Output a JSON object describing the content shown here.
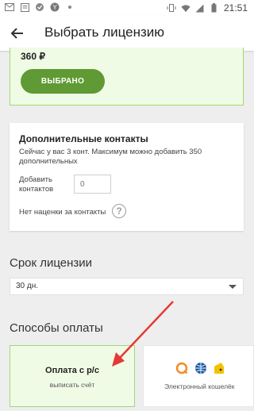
{
  "status_bar": {
    "time": "21:51",
    "left_icons": [
      "mail-icon",
      "news-icon",
      "app-icon",
      "yandex-icon",
      "dot-icon"
    ],
    "right_icons": [
      "vibrate-icon",
      "wifi-icon",
      "signal-icon",
      "battery-icon"
    ]
  },
  "app_bar": {
    "back_icon": "arrow-back-icon",
    "title": "Выбрать лицензию"
  },
  "license": {
    "price": "360 ₽",
    "selected_button": "ВЫБРАНО"
  },
  "contacts": {
    "heading": "Дополнительные контакты",
    "description": "Сейчас у вас 3 конт. Максимум можно добавить 350 дополнительных",
    "add_label": "Добавить контактов",
    "add_placeholder": "0",
    "no_markup": "Нет наценки за контакты",
    "help_icon": "?"
  },
  "term": {
    "heading": "Срок лицензии",
    "selected": "30 дн."
  },
  "payment": {
    "heading": "Способы оплаты",
    "methods": [
      {
        "title": "Оплата с р/с",
        "subtitle": "выписать счёт",
        "selected": true
      },
      {
        "title": "",
        "subtitle": "Электронный кошелёк",
        "selected": false,
        "icons": [
          "qiwi-icon",
          "webmoney-icon",
          "yandex-money-icon"
        ]
      }
    ]
  },
  "colors": {
    "accent_green": "#5f9a34",
    "selected_bg": "#f0fbe6",
    "selected_border": "#9fd773",
    "annotation_red": "#e53935"
  }
}
